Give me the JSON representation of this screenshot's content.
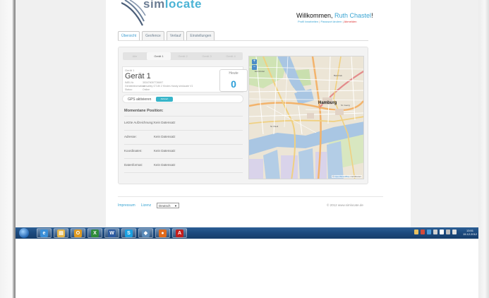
{
  "app": {
    "logo_part1": "sim",
    "logo_part2": "locate"
  },
  "header": {
    "welcome_prefix": "Willkommen,",
    "user_name": "Ruth Chastel",
    "welcome_suffix": "!",
    "link_profile": "Profil bearbeiten",
    "link_password": "Passwort ändern",
    "link_logout": "Abmelden"
  },
  "tabs": [
    {
      "label": "Übersicht",
      "active": true
    },
    {
      "label": "Geofence",
      "active": false
    },
    {
      "label": "Verlauf",
      "active": false
    },
    {
      "label": "Einstellungen",
      "active": false
    }
  ],
  "device_tabs": [
    {
      "label": "Alle",
      "active": false
    },
    {
      "label": "Gerät 1",
      "active": true
    },
    {
      "label": "Gerät 2",
      "active": false
    },
    {
      "label": "Gerät 3",
      "active": false
    },
    {
      "label": "Gerät 4",
      "active": false
    }
  ],
  "device": {
    "small_label": "Gerät 1",
    "title": "Gerät 1",
    "rows": [
      {
        "key": "IMEI-Nr.",
        "value": "353476057726697"
      },
      {
        "key": "Geräteinformation:",
        "value": "simvalley GT-80 2 Kinder-Handy simlocate V1"
      },
      {
        "key": "Status:",
        "value": "Online"
      }
    ],
    "today_label": "Heute",
    "today_count": "0"
  },
  "gps": {
    "label": "GPS aktivieren",
    "toggle_label": "Aktiviert"
  },
  "position": {
    "title": "Momentane Position:",
    "rows": [
      {
        "key": "Letzte Aufzeichnung:",
        "value": "Kein Datensatz"
      },
      {
        "key": "Adresse:",
        "value": "Kein Datensatz"
      },
      {
        "key": "Koordinaten:",
        "value": "Kein Datensatz"
      },
      {
        "key": "Datenformat:",
        "value": "Kein Datensatz"
      }
    ]
  },
  "map": {
    "city_label": "Hamburg",
    "attribution_link": "OpenStreetMap",
    "attribution_text": "contributors"
  },
  "footer": {
    "impressum": "Impressum",
    "lizenz": "Lizenz",
    "language": "Deutsch",
    "copyright": "© 2012 www.simlocate.de"
  },
  "taskbar": {
    "apps": [
      {
        "name": "ie-icon",
        "glyph": "e",
        "color": "#3a8fd8"
      },
      {
        "name": "explorer-icon",
        "glyph": "▤",
        "color": "#e4b64a"
      },
      {
        "name": "outlook-icon",
        "glyph": "O",
        "color": "#e09a20"
      },
      {
        "name": "excel-icon",
        "glyph": "X",
        "color": "#2f8c3b"
      },
      {
        "name": "word-icon",
        "glyph": "W",
        "color": "#2c5aa0"
      },
      {
        "name": "skype-icon",
        "glyph": "S",
        "color": "#1aa0e0"
      },
      {
        "name": "app-icon",
        "glyph": "◆",
        "color": "#5a8ab8"
      },
      {
        "name": "firefox-icon",
        "glyph": "●",
        "color": "#e06a1c"
      },
      {
        "name": "acrobat-icon",
        "glyph": "A",
        "color": "#c21e1e"
      }
    ],
    "clock_time": "13:51",
    "clock_date": "15.12.2012"
  }
}
